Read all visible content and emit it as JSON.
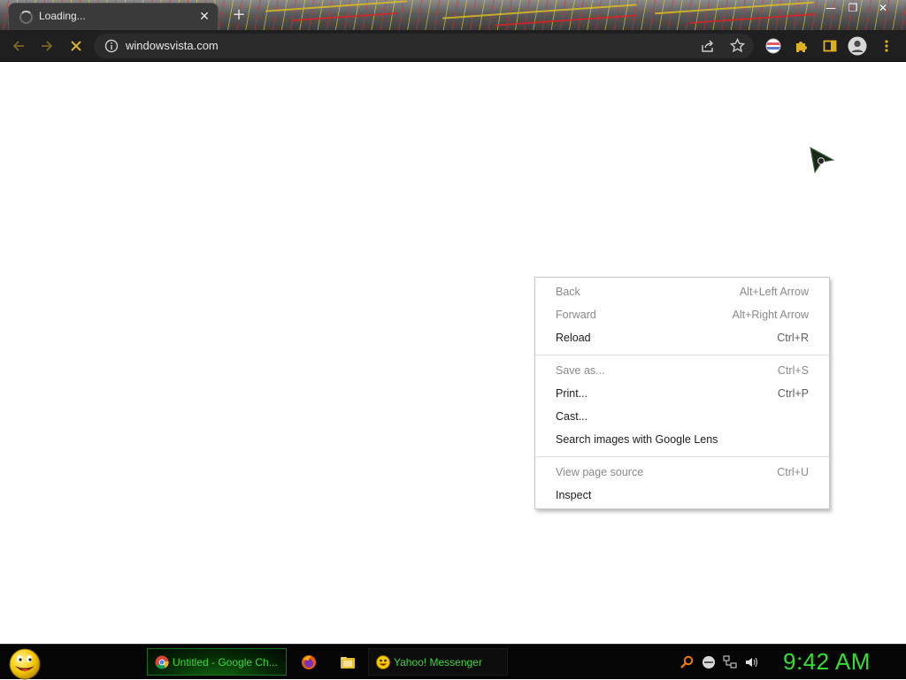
{
  "window": {
    "minimize_glyph": "—",
    "restore_glyph": "❐",
    "close_glyph": "✕"
  },
  "tab": {
    "title": "Loading...",
    "close_glyph": "✕",
    "new_tab_glyph": "+"
  },
  "toolbar": {
    "url": "windowsvista.com",
    "icons": [
      "back-icon",
      "forward-icon",
      "stop-icon",
      "info-icon",
      "share-icon",
      "bookmark-star-icon",
      "extension-flag-icon",
      "extensions-puzzle-icon",
      "side-panel-icon",
      "profile-icon",
      "menu-icon"
    ]
  },
  "context_menu": {
    "groups": [
      [
        {
          "label": "Back",
          "shortcut": "Alt+Left Arrow",
          "enabled": false
        },
        {
          "label": "Forward",
          "shortcut": "Alt+Right Arrow",
          "enabled": false
        },
        {
          "label": "Reload",
          "shortcut": "Ctrl+R",
          "enabled": true
        }
      ],
      [
        {
          "label": "Save as...",
          "shortcut": "Ctrl+S",
          "enabled": false
        },
        {
          "label": "Print...",
          "shortcut": "Ctrl+P",
          "enabled": true
        },
        {
          "label": "Cast...",
          "shortcut": "",
          "enabled": true
        },
        {
          "label": "Search images with Google Lens",
          "shortcut": "",
          "enabled": true
        }
      ],
      [
        {
          "label": "View page source",
          "shortcut": "Ctrl+U",
          "enabled": false
        },
        {
          "label": "Inspect",
          "shortcut": "",
          "enabled": true
        }
      ]
    ]
  },
  "taskbar": {
    "tasks": [
      {
        "label": "Untitled - Google Ch...",
        "icon": "chrome-icon",
        "active": true
      },
      {
        "label": "Yahoo! Messenger",
        "icon": "yahoo-messenger-icon",
        "active": false
      }
    ],
    "quick_launch": [
      "firefox-icon",
      "folder-icon"
    ],
    "tray": [
      "search-tray-icon",
      "network-globe-icon",
      "network-icon",
      "volume-icon"
    ],
    "clock": "9:42 AM"
  },
  "colors": {
    "toolbar_bg": "#1f1f1f",
    "omnibox_bg": "#2b2b2b",
    "taskbar_bg": "#050505",
    "taskbar_text": "#3cd83c",
    "clock_text": "#2ee02e",
    "extension_accent": "#e0b020"
  }
}
